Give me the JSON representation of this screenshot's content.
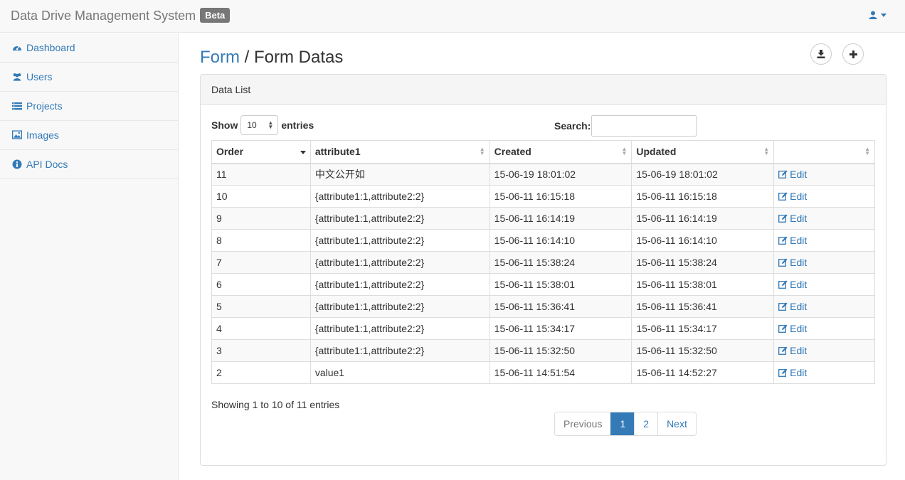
{
  "navbar": {
    "brand": "Data Drive Management System",
    "badge": "Beta"
  },
  "sidebar": {
    "items": [
      {
        "label": "Dashboard",
        "icon": "dashboard-icon"
      },
      {
        "label": "Users",
        "icon": "users-icon"
      },
      {
        "label": "Projects",
        "icon": "list-icon"
      },
      {
        "label": "Images",
        "icon": "image-icon"
      },
      {
        "label": "API Docs",
        "icon": "info-icon"
      }
    ]
  },
  "header": {
    "breadcrumb_link": "Form",
    "separator": " / ",
    "title": "Form Datas"
  },
  "panel": {
    "heading": "Data List",
    "show_label": "Show",
    "entries_label": "entries",
    "length_value": "10",
    "search_label": "Search:",
    "search_value": ""
  },
  "table": {
    "columns": [
      "Order",
      "attribute1",
      "Created",
      "Updated",
      ""
    ],
    "edit_label": "Edit",
    "rows": [
      {
        "order": "11",
        "attribute1": "中文公开如",
        "created": "15-06-19 18:01:02",
        "updated": "15-06-19 18:01:02"
      },
      {
        "order": "10",
        "attribute1": "{attribute1:1,attribute2:2}",
        "created": "15-06-11 16:15:18",
        "updated": "15-06-11 16:15:18"
      },
      {
        "order": "9",
        "attribute1": "{attribute1:1,attribute2:2}",
        "created": "15-06-11 16:14:19",
        "updated": "15-06-11 16:14:19"
      },
      {
        "order": "8",
        "attribute1": "{attribute1:1,attribute2:2}",
        "created": "15-06-11 16:14:10",
        "updated": "15-06-11 16:14:10"
      },
      {
        "order": "7",
        "attribute1": "{attribute1:1,attribute2:2}",
        "created": "15-06-11 15:38:24",
        "updated": "15-06-11 15:38:24"
      },
      {
        "order": "6",
        "attribute1": "{attribute1:1,attribute2:2}",
        "created": "15-06-11 15:38:01",
        "updated": "15-06-11 15:38:01"
      },
      {
        "order": "5",
        "attribute1": "{attribute1:1,attribute2:2}",
        "created": "15-06-11 15:36:41",
        "updated": "15-06-11 15:36:41"
      },
      {
        "order": "4",
        "attribute1": "{attribute1:1,attribute2:2}",
        "created": "15-06-11 15:34:17",
        "updated": "15-06-11 15:34:17"
      },
      {
        "order": "3",
        "attribute1": "{attribute1:1,attribute2:2}",
        "created": "15-06-11 15:32:50",
        "updated": "15-06-11 15:32:50"
      },
      {
        "order": "2",
        "attribute1": "value1",
        "created": "15-06-11 14:51:54",
        "updated": "15-06-11 14:52:27"
      }
    ]
  },
  "footer": {
    "info": "Showing 1 to 10 of 11 entries",
    "pagination": {
      "previous": "Previous",
      "pages": [
        "1",
        "2"
      ],
      "next": "Next"
    }
  },
  "colors": {
    "link": "#337ab7",
    "active_page": "#337ab7",
    "badge": "#777777"
  }
}
